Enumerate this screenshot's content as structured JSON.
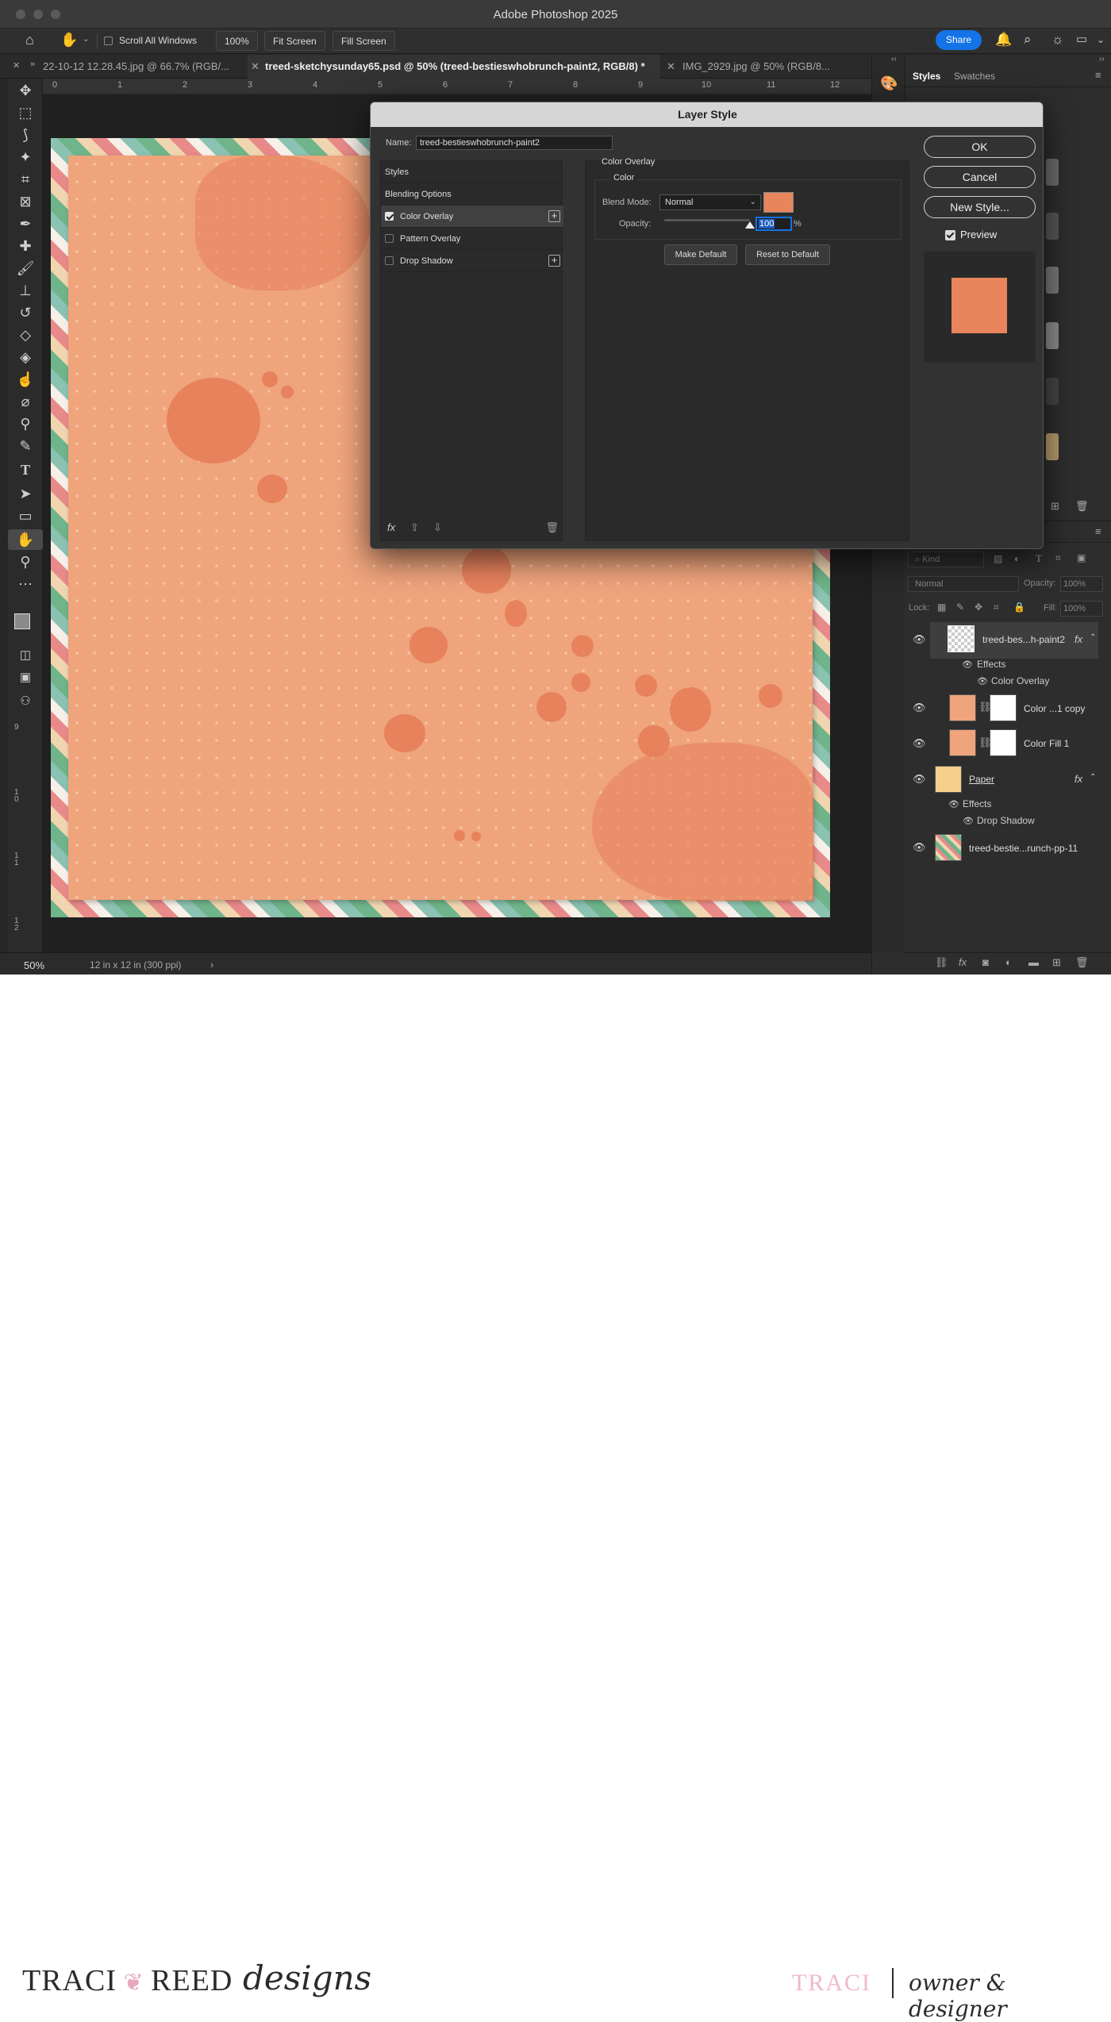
{
  "app": {
    "title": "Adobe Photoshop 2025"
  },
  "options_bar": {
    "scroll_all_windows": "Scroll All Windows",
    "zoom_button": "100%",
    "fit_screen": "Fit Screen",
    "fill_screen": "Fill Screen",
    "share": "Share"
  },
  "tabs": [
    {
      "label": "22-10-12 12.28.45.jpg @ 66.7% (RGB/..."
    },
    {
      "label": "treed-sketchysunday65.psd @ 50% (treed-bestieswhobrunch-paint2, RGB/8) *"
    },
    {
      "label": "IMG_2929.jpg @ 50% (RGB/8..."
    }
  ],
  "ruler_top": [
    "0",
    "1",
    "2",
    "3",
    "4",
    "5",
    "6",
    "7",
    "8",
    "9",
    "10",
    "11",
    "12"
  ],
  "ruler_left": [
    "9",
    "1\n0",
    "1\n1",
    "1\n2"
  ],
  "status": {
    "zoom": "50%",
    "doc_size": "12 in x 12 in (300 ppi)",
    "arrow": "›"
  },
  "styles_panel": {
    "tab_styles": "Styles",
    "tab_swatches": "Swatches"
  },
  "layers_panel": {
    "kind": "Kind",
    "blend": "Normal",
    "opacity_label": "Opacity:",
    "opacity_value": "100%",
    "lock_label": "Lock:",
    "fill_label": "Fill:",
    "fill_value": "100%",
    "layers": [
      {
        "name": "treed-bes...h-paint2",
        "fx": "fx",
        "effects": "Effects",
        "effect_items": [
          "Color Overlay"
        ]
      },
      {
        "name": "Color ...1 copy"
      },
      {
        "name": "Color Fill 1"
      },
      {
        "name": "Paper",
        "fx": "fx",
        "effects": "Effects",
        "effect_items": [
          "Drop Shadow"
        ]
      },
      {
        "name": "treed-bestie...runch-pp-11"
      }
    ]
  },
  "dialog": {
    "title": "Layer Style",
    "name_label": "Name:",
    "name_value": "treed-bestieswhobrunch-paint2",
    "style_list": [
      {
        "label": "Styles"
      },
      {
        "label": "Blending Options"
      },
      {
        "label": "Color Overlay",
        "checked": true
      },
      {
        "label": "Pattern Overlay",
        "checked": false
      },
      {
        "label": "Drop Shadow",
        "checked": false
      }
    ],
    "section_title": "Color Overlay",
    "group_title": "Color",
    "blend_mode_label": "Blend Mode:",
    "blend_mode_value": "Normal",
    "overlay_color": "#e9855c",
    "opacity_label": "Opacity:",
    "opacity_value": "100",
    "opacity_unit": "%",
    "opacity_level": 1.0,
    "make_default": "Make Default",
    "reset_default": "Reset to Default",
    "ok": "OK",
    "cancel": "Cancel",
    "new_style": "New Style...",
    "preview": "Preview",
    "preview_checked": true
  },
  "branding": {
    "logo_main": "TRACI",
    "logo_main2": "REED",
    "logo_script": "designs",
    "name": "TRACI",
    "role": "owner & designer"
  }
}
